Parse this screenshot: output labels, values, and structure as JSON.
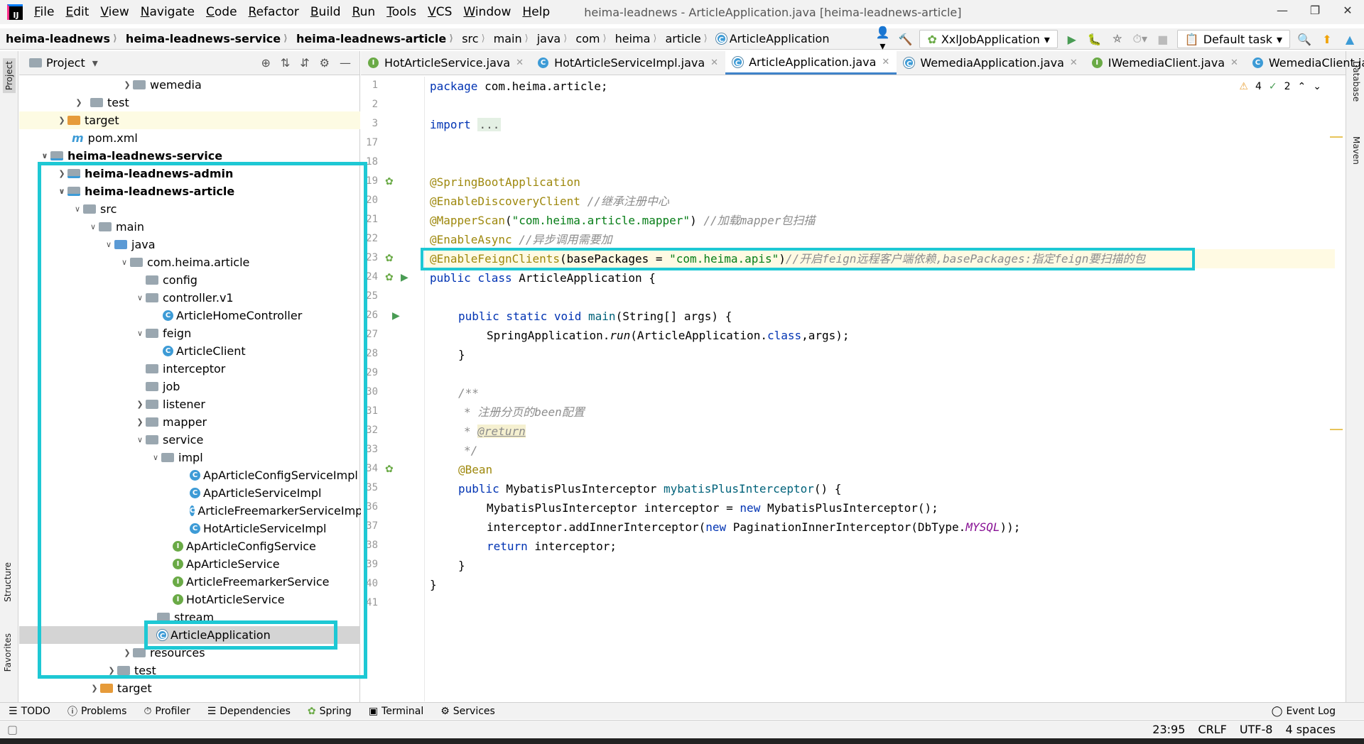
{
  "window_title": "heima-leadnews - ArticleApplication.java [heima-leadnews-article]",
  "menu": [
    "File",
    "Edit",
    "View",
    "Navigate",
    "Code",
    "Refactor",
    "Build",
    "Run",
    "Tools",
    "VCS",
    "Window",
    "Help"
  ],
  "breadcrumbs": [
    "heima-leadnews",
    "heima-leadnews-service",
    "heima-leadnews-article",
    "src",
    "main",
    "java",
    "com",
    "heima",
    "article",
    "ArticleApplication"
  ],
  "toolbar": {
    "run_config": "XxlJobApplication",
    "task": "Default task"
  },
  "project_panel": {
    "title": "Project"
  },
  "side_tabs": {
    "project": "Project",
    "structure": "Structure",
    "favorites": "Favorites",
    "database": "Database",
    "maven": "Maven"
  },
  "tree": [
    {
      "label": "wemedia"
    },
    {
      "label": "test"
    },
    {
      "label": "target"
    },
    {
      "label": "pom.xml"
    },
    {
      "label": "heima-leadnews-service"
    },
    {
      "label": "heima-leadnews-admin"
    },
    {
      "label": "heima-leadnews-article"
    },
    {
      "label": "src"
    },
    {
      "label": "main"
    },
    {
      "label": "java"
    },
    {
      "label": "com.heima.article"
    },
    {
      "label": "config"
    },
    {
      "label": "controller.v1"
    },
    {
      "label": "ArticleHomeController"
    },
    {
      "label": "feign"
    },
    {
      "label": "ArticleClient"
    },
    {
      "label": "interceptor"
    },
    {
      "label": "job"
    },
    {
      "label": "listener"
    },
    {
      "label": "mapper"
    },
    {
      "label": "service"
    },
    {
      "label": "impl"
    },
    {
      "label": "ApArticleConfigServiceImpl"
    },
    {
      "label": "ApArticleServiceImpl"
    },
    {
      "label": "ArticleFreemarkerServiceImp"
    },
    {
      "label": "HotArticleServiceImpl"
    },
    {
      "label": "ApArticleConfigService"
    },
    {
      "label": "ApArticleService"
    },
    {
      "label": "ArticleFreemarkerService"
    },
    {
      "label": "HotArticleService"
    },
    {
      "label": "stream"
    },
    {
      "label": "ArticleApplication"
    },
    {
      "label": "resources"
    },
    {
      "label": "test"
    },
    {
      "label": "target"
    }
  ],
  "tabs": [
    "HotArticleService.java",
    "HotArticleServiceImpl.java",
    "ArticleApplication.java",
    "WemediaApplication.java",
    "IWemediaClient.java",
    "WemediaClient.java"
  ],
  "editor": {
    "warnings": "4",
    "checks": "2",
    "line_numbers": [
      "1",
      "2",
      "3",
      "17",
      "18",
      "19",
      "20",
      "21",
      "22",
      "23",
      "24",
      "25",
      "26",
      "27",
      "28",
      "29",
      "30",
      "31",
      "32",
      "33",
      "34",
      "35",
      "36",
      "37",
      "38",
      "39",
      "40",
      "41"
    ],
    "code": {
      "l1a": "package",
      "l1b": " com.heima.article;",
      "l3a": "import",
      "l3b": "...",
      "l19": "@SpringBootApplication",
      "l20a": "@EnableDiscoveryClient",
      "l20b": "//继承注册中心",
      "l21a": "@MapperScan",
      "l21b": "(",
      "l21c": "\"com.heima.article.mapper\"",
      "l21d": ") ",
      "l21e": "//加载mapper包扫描",
      "l22a": "@EnableAsync",
      "l22b": "//异步调用需要加",
      "l23a": "@EnableFeignClients",
      "l23b": "(basePackages = ",
      "l23c": "\"com.heima.apis\"",
      "l23d": ")",
      "l23e": "//开启feign远程客户端依赖,basePackages:指定feign要扫描的包",
      "l24a": "public class",
      "l24b": " ArticleApplication {",
      "l26a": "public static void",
      "l26b": "main",
      "l26c": "(String[] args) {",
      "l27a": "SpringApplication.",
      "l27b": "run",
      "l27c": "(ArticleApplication.",
      "l27d": "class",
      "l27e": ",args);",
      "l28": "}",
      "l30": "/**",
      "l31": "* 注册分页的been配置",
      "l32a": "*",
      "l32b": "@return",
      "l33": "*/",
      "l34": "@Bean",
      "l35a": "public",
      "l35b": " MybatisPlusInterceptor ",
      "l35c": "mybatisPlusInterceptor",
      "l35d": "() {",
      "l36a": "MybatisPlusInterceptor interceptor = ",
      "l36b": "new",
      "l36c": " MybatisPlusInterceptor();",
      "l37a": "interceptor.addInnerInterceptor(",
      "l37b": "new",
      "l37c": " PaginationInnerInterceptor(DbType.",
      "l37d": "MYSQL",
      "l37e": "));",
      "l38a": "return",
      "l38b": " interceptor;",
      "l39": "}",
      "l40": "}"
    }
  },
  "bottom_tools": [
    "TODO",
    "Problems",
    "Profiler",
    "Dependencies",
    "Spring",
    "Terminal",
    "Services",
    "Event Log"
  ],
  "status": {
    "position": "23:95",
    "line_sep": "CRLF",
    "encoding": "UTF-8",
    "indent": "4 spaces"
  }
}
